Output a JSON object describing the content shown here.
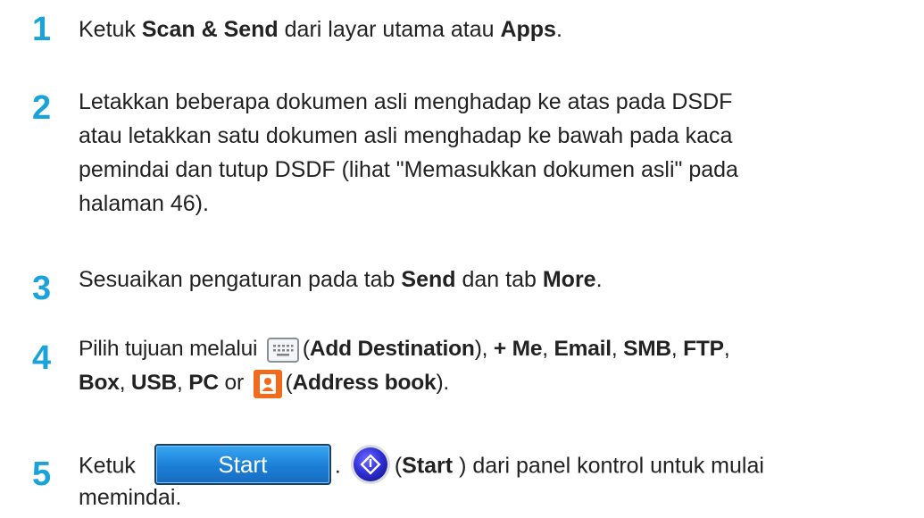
{
  "steps": [
    {
      "num": "1",
      "t1": "Ketuk ",
      "b1": "Scan & Send",
      "t2": " dari layar utama atau ",
      "b2": "Apps",
      "t3": "."
    },
    {
      "num": "2",
      "lines": [
        "Letakkan beberapa dokumen asli menghadap ke atas pada DSDF",
        "atau letakkan satu dokumen asli menghadap ke bawah pada kaca",
        "pemindai dan tutup DSDF (lihat \"Memasukkan dokumen asli\" pada",
        "halaman 46)."
      ]
    },
    {
      "num": "3",
      "t1": "Sesuaikan pengaturan pada tab ",
      "b1": "Send",
      "t2": " dan tab ",
      "b2": "More",
      "t3": "."
    },
    {
      "num": "4",
      "l1_t1": "Pilih tujuan melalui ",
      "l1_b1": "Add Destination",
      "l1_b2": "+ Me",
      "l1_b3": "Email",
      "l1_b4": "SMB",
      "l1_b5": "FTP",
      "l2_b1": "Box",
      "l2_b2": "USB",
      "l2_b3": "PC",
      "l2_t_or": " or ",
      "l2_b4": "Address book",
      "icons": [
        "keyboard-icon",
        "address-book-icon"
      ]
    },
    {
      "num": "5",
      "t1": "Ketuk ",
      "button_label": "Start",
      "b1": "Start",
      "t2": " ) dari panel kontrol untuk mulai",
      "line2": "memindai.",
      "icons": [
        "start-hard-button-icon"
      ]
    }
  ],
  "colors": {
    "step_number": "#1aa3d9",
    "start_button": "#1b7fd6",
    "address_book": "#f26a1b"
  }
}
